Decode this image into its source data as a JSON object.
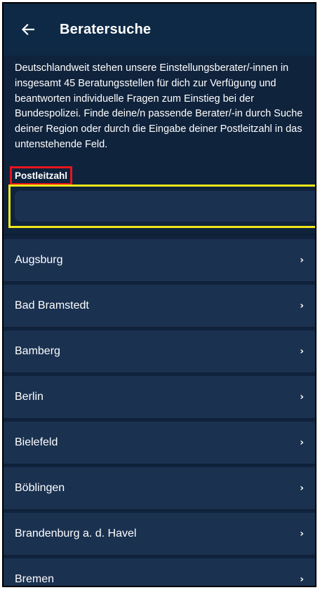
{
  "appbar": {
    "back_icon": "arrow-left-icon",
    "title": "Beratersuche"
  },
  "intro": {
    "text": "Deutschlandweit stehen unsere Einstellungsberater/-innen in insgesamt 45 Beratungsstellen für dich zur Verfügung und beantworten individuelle Fragen zum Einstieg bei der Bundespolizei. Finde deine/n passende Berater/-in durch Suche deiner Region oder durch die Eingabe deiner Postleitzahl in das untenstehende Feld."
  },
  "search": {
    "label": "Postleitzahl",
    "value": "",
    "placeholder": ""
  },
  "list": {
    "chevron_icon": "chevron-right-icon",
    "chevron_glyph": "›",
    "items": [
      {
        "label": "Augsburg"
      },
      {
        "label": "Bad Bramstedt"
      },
      {
        "label": "Bamberg"
      },
      {
        "label": "Berlin"
      },
      {
        "label": "Bielefeld"
      },
      {
        "label": "Böblingen"
      },
      {
        "label": "Brandenburg a. d. Havel"
      },
      {
        "label": "Bremen"
      }
    ]
  },
  "colors": {
    "background": "#10233c",
    "appbar": "#0e2945",
    "list_item": "#1a3150",
    "label_highlight": "#e8141b",
    "input_highlight": "#f0e81a"
  }
}
